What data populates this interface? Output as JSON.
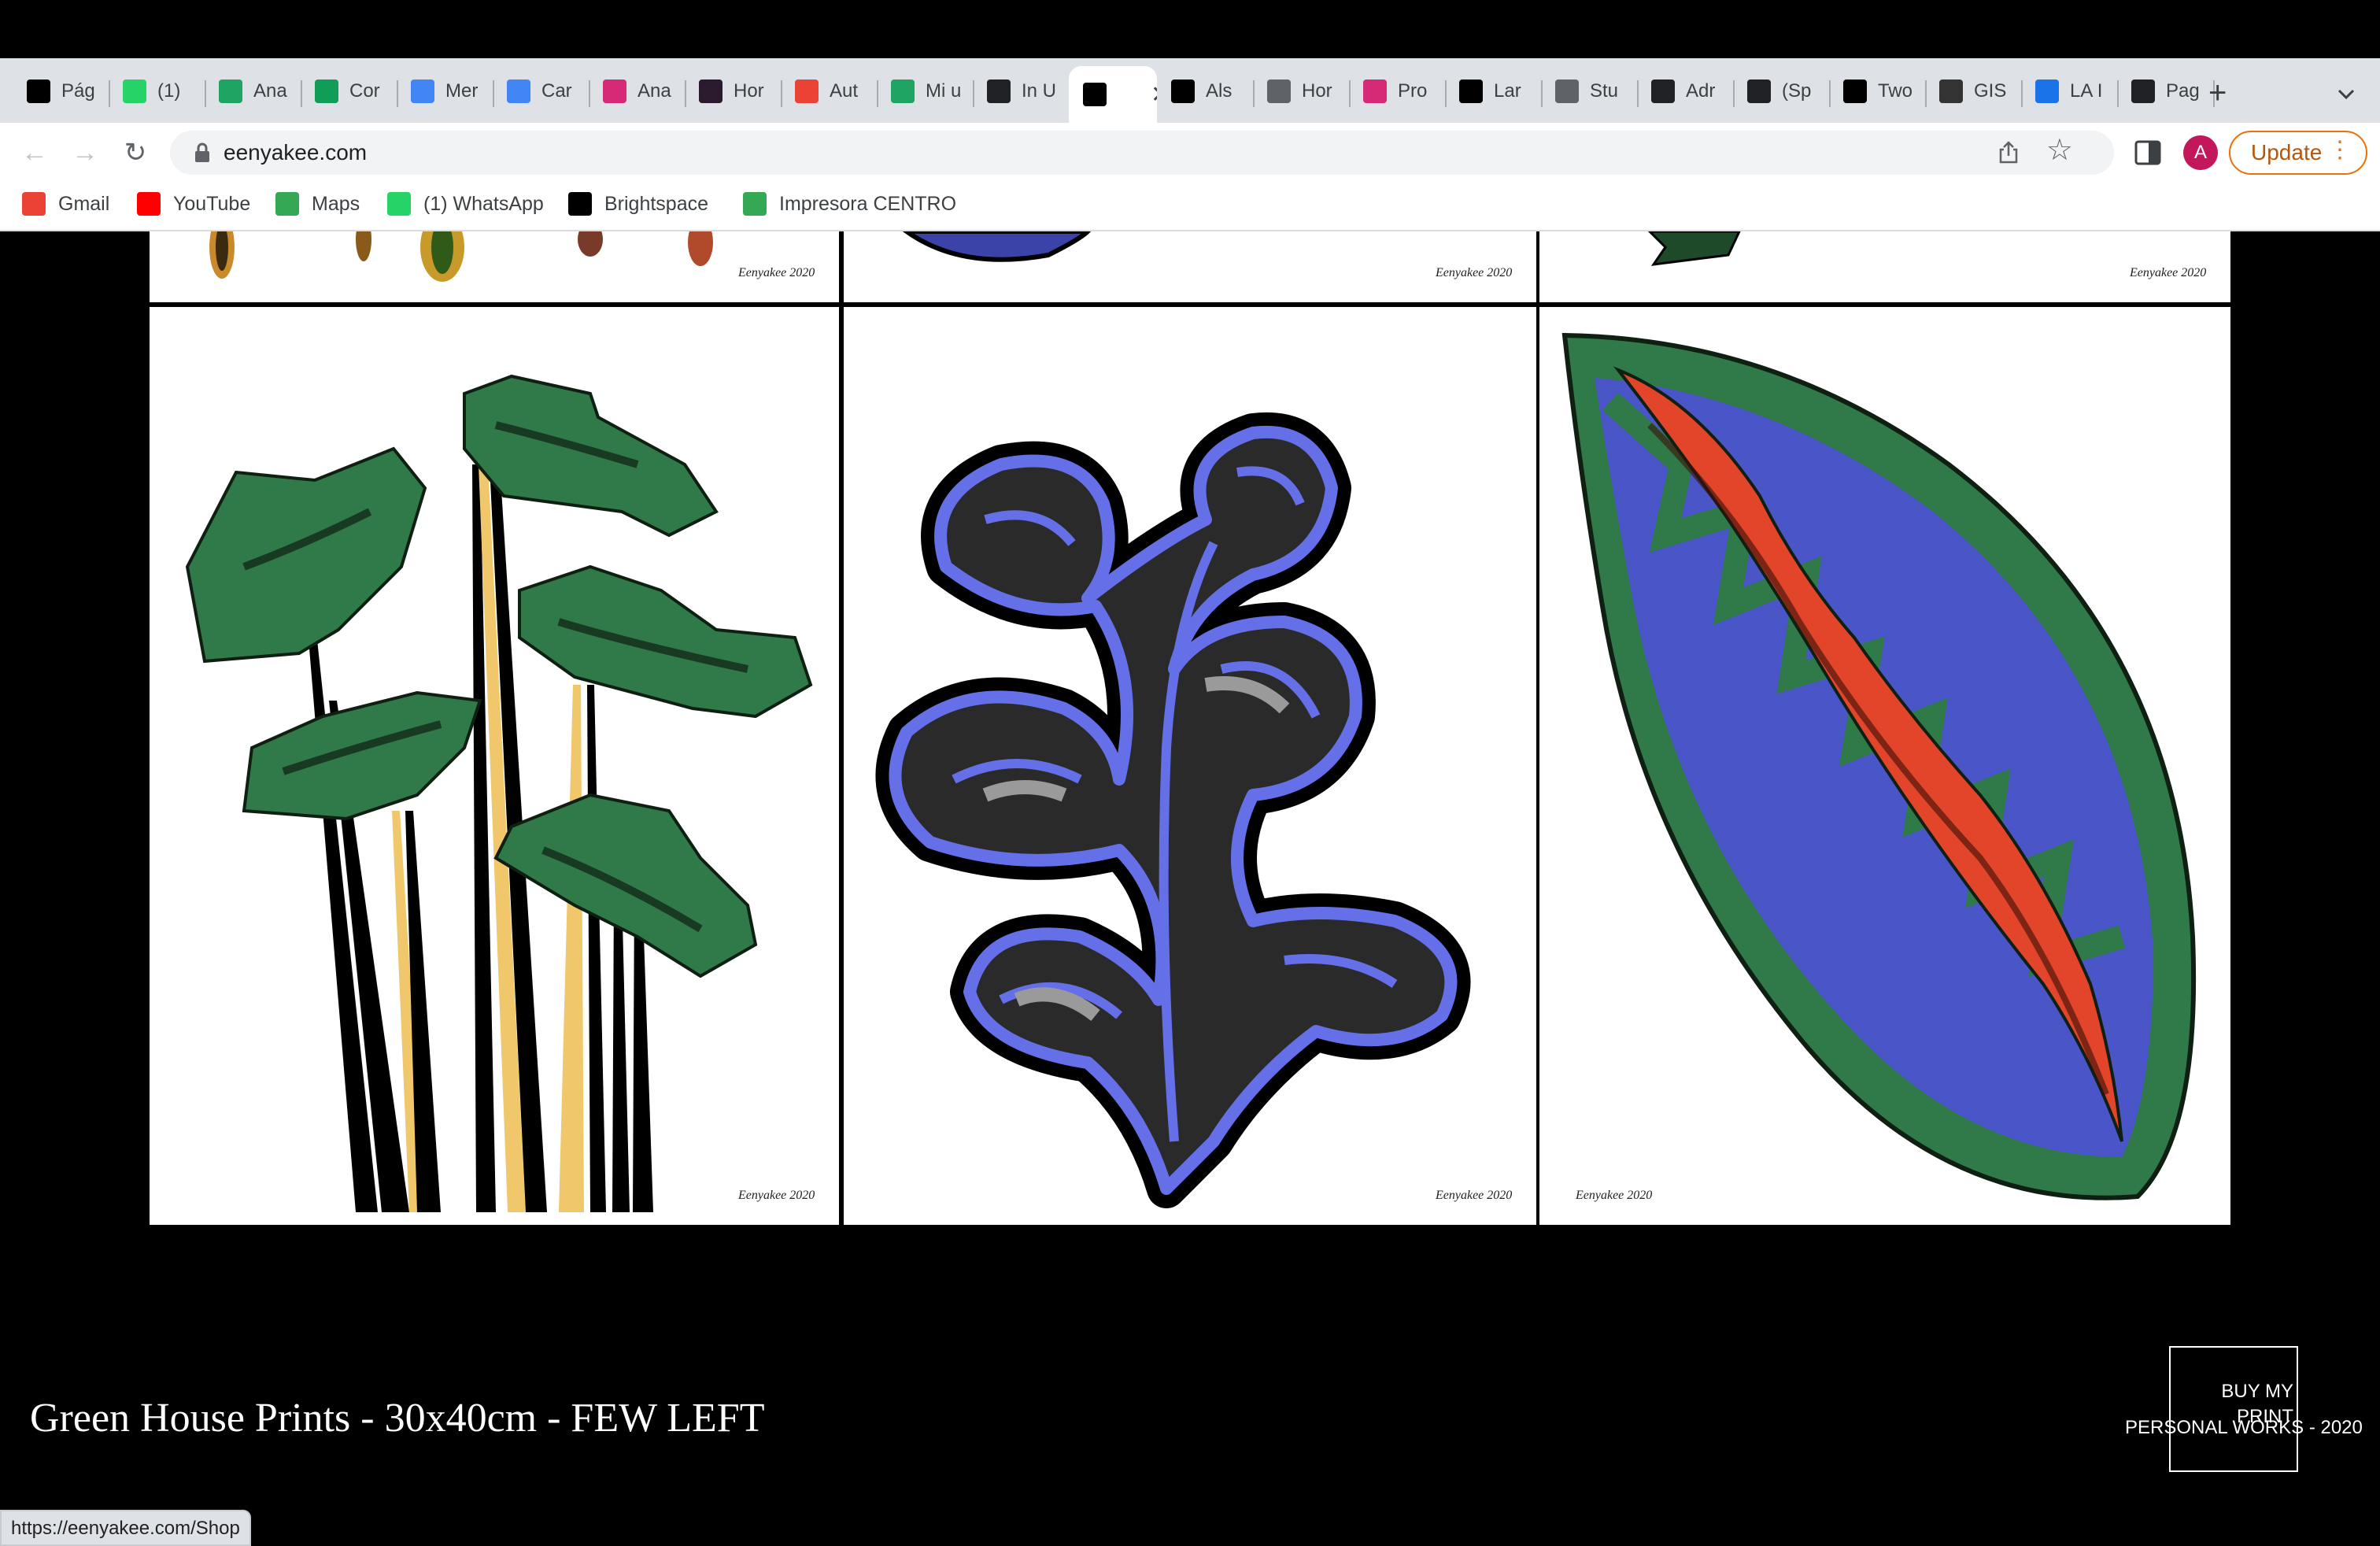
{
  "browser": {
    "tabs": [
      {
        "label": "Pág",
        "icon": "d2l-icon",
        "color": "#000000"
      },
      {
        "label": "(1)",
        "icon": "whatsapp-icon",
        "color": "#25d366"
      },
      {
        "label": "Ana",
        "icon": "google-drive-icon",
        "color": "#1fa463"
      },
      {
        "label": "Cor",
        "icon": "google-sheets-icon",
        "color": "#0f9d58"
      },
      {
        "label": "Mer",
        "icon": "google-docs-icon",
        "color": "#4285f4"
      },
      {
        "label": "Car",
        "icon": "google-docs-icon",
        "color": "#4285f4"
      },
      {
        "label": "Ana",
        "icon": "instagram-icon",
        "color": "#d62976"
      },
      {
        "label": "Hor",
        "icon": "circle-icon",
        "color": "#2b1a2e"
      },
      {
        "label": "Aut",
        "icon": "gmail-icon",
        "color": "#ea4335"
      },
      {
        "label": "Mi u",
        "icon": "google-drive-icon",
        "color": "#1fa463"
      },
      {
        "label": "In U",
        "icon": "bolt-icon",
        "color": "#202124"
      },
      {
        "label": "",
        "icon": "ee-logo-icon",
        "color": "#000000",
        "active": true
      },
      {
        "label": "Als",
        "icon": "circle-icon",
        "color": "#000000"
      },
      {
        "label": "Hor",
        "icon": "smiley-icon",
        "color": "#5f6368"
      },
      {
        "label": "Pro",
        "icon": "instagram-icon",
        "color": "#d62976"
      },
      {
        "label": "Lar",
        "icon": "circle-icon",
        "color": "#000000"
      },
      {
        "label": "Stu",
        "icon": "x-icon",
        "color": "#5f6368"
      },
      {
        "label": "Adr",
        "icon": "bolt-icon",
        "color": "#202124"
      },
      {
        "label": "(Sp",
        "icon": "bolt-icon",
        "color": "#202124"
      },
      {
        "label": "Two",
        "icon": "j-icon",
        "color": "#000000"
      },
      {
        "label": "GIS",
        "icon": "gis-icon",
        "color": "#333333"
      },
      {
        "label": "LA I",
        "icon": "globe-icon",
        "color": "#1a73e8"
      },
      {
        "label": "Pag",
        "icon": "bolt-icon",
        "color": "#202124"
      }
    ],
    "close_glyph": "✕",
    "new_tab_glyph": "+",
    "url": "eenyakee.com",
    "avatar_letter": "A",
    "update_label": "Update",
    "update_dots": "⋮",
    "bookmarks": [
      {
        "label": "Gmail",
        "icon": "gmail-icon",
        "color": "#ea4335"
      },
      {
        "label": "YouTube",
        "icon": "youtube-icon",
        "color": "#ff0000"
      },
      {
        "label": "Maps",
        "icon": "maps-icon",
        "color": "#34a853"
      },
      {
        "label": "(1) WhatsApp",
        "icon": "whatsapp-icon",
        "color": "#25d366"
      },
      {
        "label": "Brightspace",
        "icon": "d2l-icon",
        "color": "#000000"
      },
      {
        "label": "Impresora CENTRO",
        "icon": "flag-icon",
        "color": "#34a853"
      }
    ],
    "status_url": "https://eenyakee.com/Shop"
  },
  "page": {
    "signature": "Eenyakee 2020",
    "shop_title": "Green House Prints - 30x40cm - FEW LEFT",
    "buy_label": "BUY MY PRINT",
    "personal_work": "PERSONAL WORKS - 2020",
    "colors": {
      "green": "#2f7a48",
      "blue": "#6570e8",
      "red": "#e2452a",
      "yellow": "#f1c76b"
    }
  }
}
